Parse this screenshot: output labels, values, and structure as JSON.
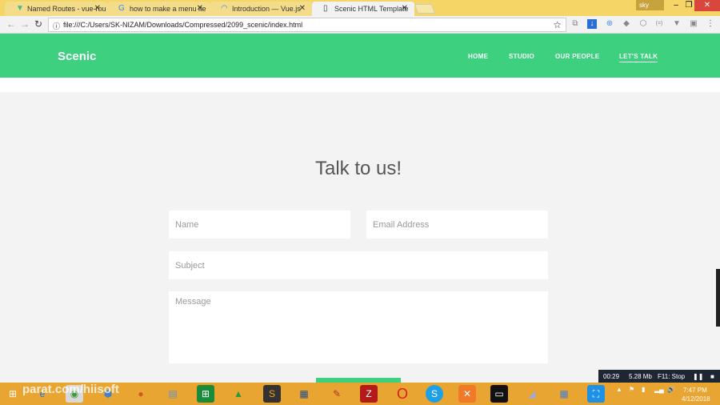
{
  "browser": {
    "tabs": [
      {
        "title": "Named Routes - vue-rou",
        "icon": "vue-icon"
      },
      {
        "title": "how to make a menu ite",
        "icon": "google-icon"
      },
      {
        "title": "Introduction — Vue.js",
        "icon": "loading-icon"
      },
      {
        "title": "Scenic HTML Template",
        "icon": "page-icon"
      }
    ],
    "user": "sky",
    "url": "file:///C:/Users/SK-NIZAM/Downloads/Compressed/2099_scenic/index.html"
  },
  "site": {
    "logo": "Scenic",
    "nav": [
      "HOME",
      "STUDIO",
      "OUR PEOPLE",
      "LET'S TALK"
    ],
    "heading": "Talk to us!",
    "form": {
      "name": "Name",
      "email": "Email Address",
      "subject": "Subject",
      "message": "Message"
    }
  },
  "recorder": {
    "time": "00:29",
    "size": "5.28 Mb",
    "stop": "F11: Stop"
  },
  "clock": {
    "time": "7:47 PM",
    "date": "4/12/2018"
  },
  "watermark": "parat.com/hiisoft"
}
